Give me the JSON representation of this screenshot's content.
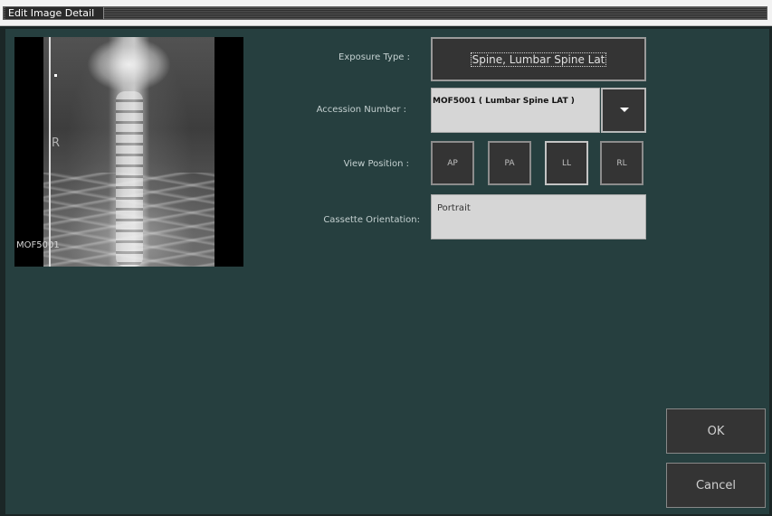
{
  "window": {
    "title": "Edit Image Detail"
  },
  "viewer": {
    "label": "MOF5001",
    "side_marker": "R"
  },
  "form": {
    "exposure_type": {
      "label": "Exposure Type :",
      "value": "Spine, Lumbar Spine Lat"
    },
    "accession_number": {
      "label": "Accession Number :",
      "value": "MOF5001 ( Lumbar Spine LAT )"
    },
    "view_position": {
      "label": "View Position :",
      "options": [
        "AP",
        "PA",
        "LL",
        "RL"
      ]
    },
    "cassette_orientation": {
      "label": "Cassette Orientation:",
      "value": "Portrait"
    }
  },
  "actions": {
    "ok_label": "OK",
    "cancel_label": "Cancel"
  },
  "colors": {
    "background": "#263f3f",
    "button": "#343434",
    "field": "#d6d6d6"
  }
}
